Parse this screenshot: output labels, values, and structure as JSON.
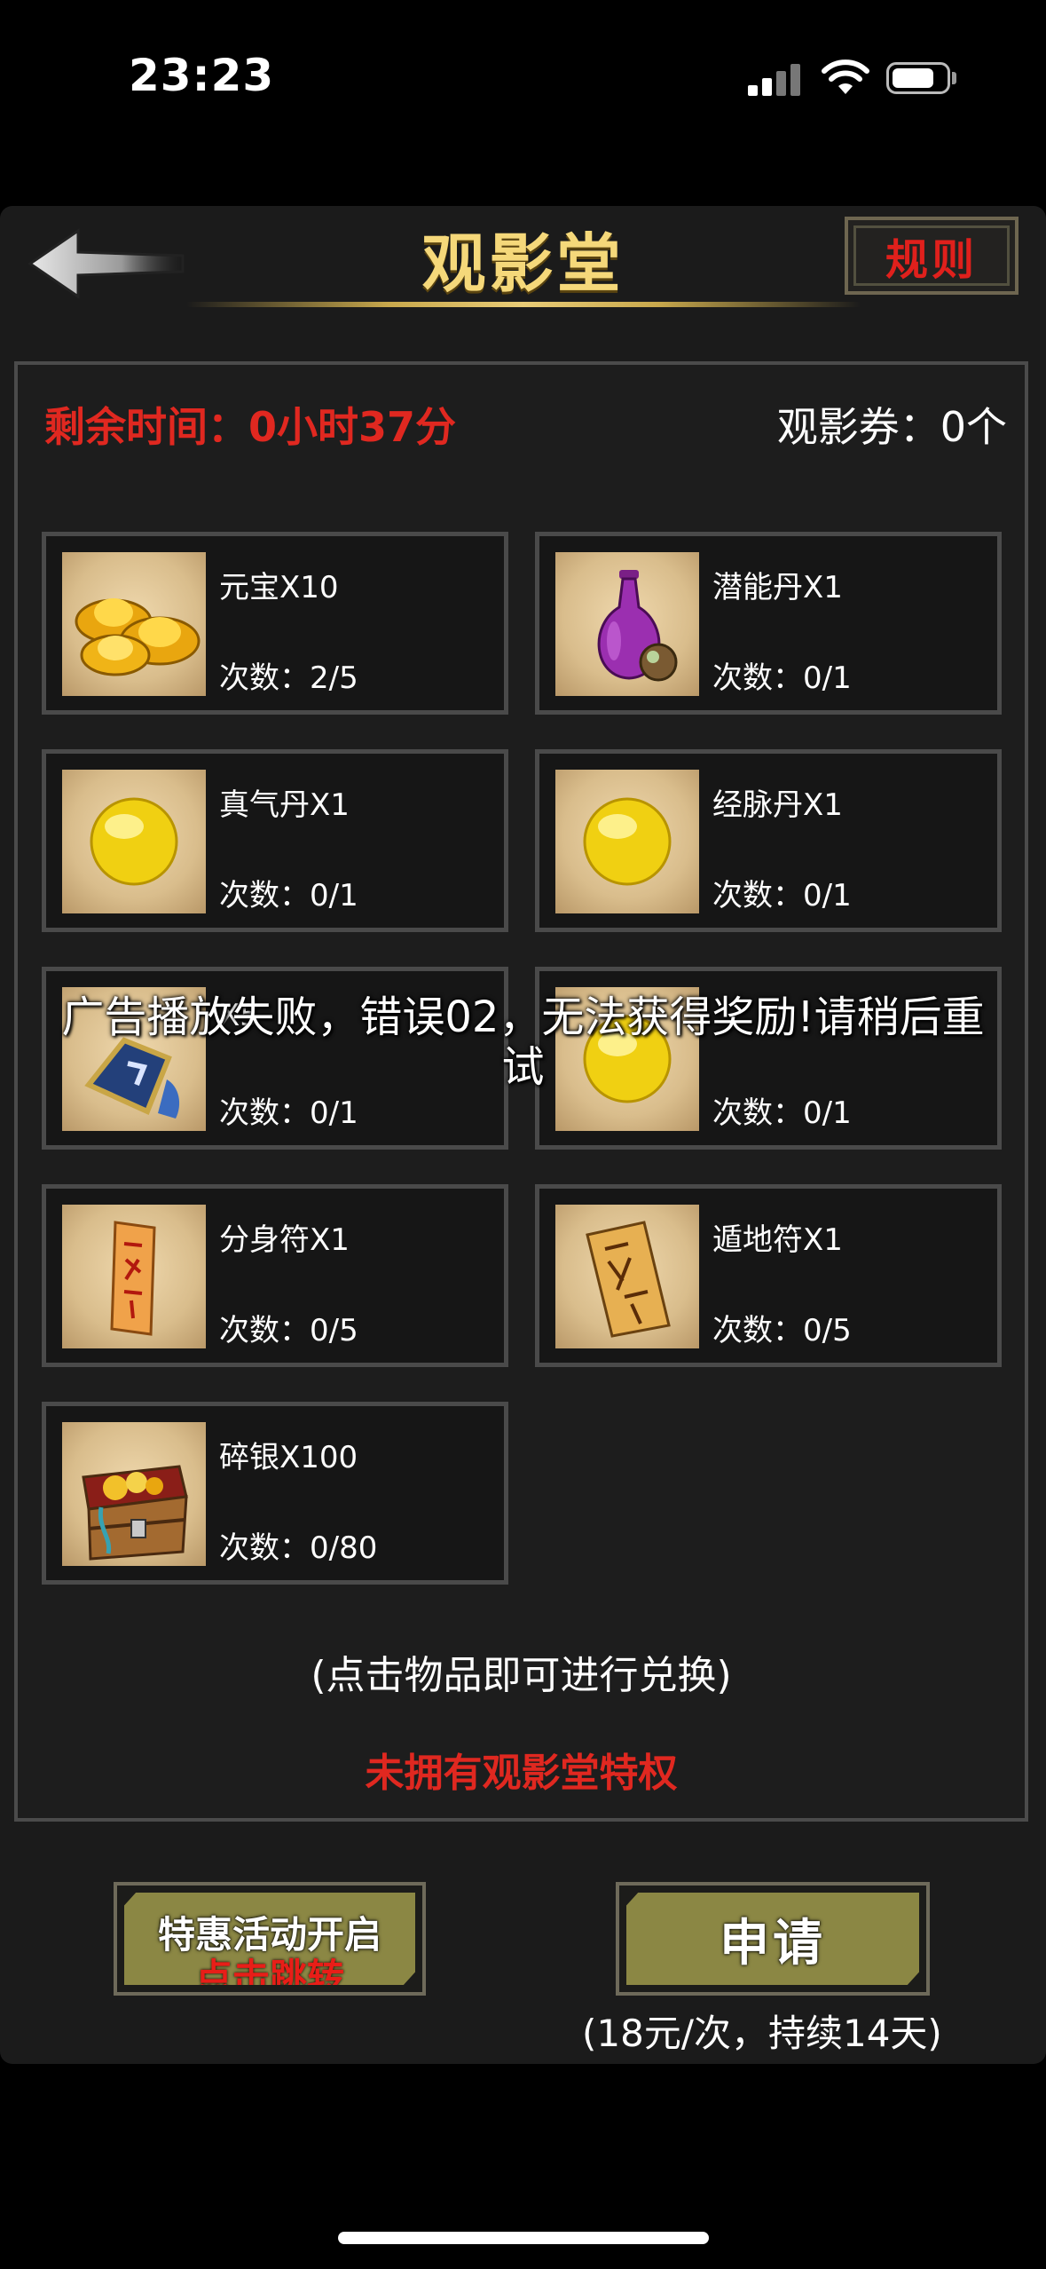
{
  "status_bar": {
    "time": "23:23"
  },
  "header": {
    "title": "观影堂",
    "rules_label": "规则"
  },
  "info": {
    "remaining_time": "剩余时间：0小时37分",
    "ticket_count": "观影券：0个"
  },
  "items": [
    {
      "name": "元宝X10",
      "count": "次数：2/5",
      "icon": "gold-ingot-icon"
    },
    {
      "name": "潜能丹X1",
      "count": "次数：0/1",
      "icon": "purple-vase-icon"
    },
    {
      "name": "真气丹X1",
      "count": "次数：0/1",
      "icon": "yellow-pill-icon"
    },
    {
      "name": "经脉丹X1",
      "count": "次数：0/1",
      "icon": "yellow-pill-icon"
    },
    {
      "name": "X5",
      "count": "次数：0/1",
      "icon": "token-bag-icon"
    },
    {
      "name": "",
      "count": "次数：0/1",
      "icon": "yellow-pill-icon"
    },
    {
      "name": "分身符X1",
      "count": "次数：0/5",
      "icon": "paper-talisman-icon"
    },
    {
      "name": "遁地符X1",
      "count": "次数：0/5",
      "icon": "paper-talisman-icon"
    },
    {
      "name": "碎银X100",
      "count": "次数：0/80",
      "icon": "treasure-chest-icon"
    }
  ],
  "hint": "(点击物品即可进行兑换)",
  "privilege_status": "未拥有观影堂特权",
  "event_button": {
    "line1": "特惠活动开启",
    "line2": "点击跳转"
  },
  "apply_button": {
    "label": "申请"
  },
  "price_note": "(18元/次，持续14天)",
  "toast": {
    "line1": "广告播放失败，错误02，无法获得奖励!请稍后重",
    "line2": "试"
  }
}
